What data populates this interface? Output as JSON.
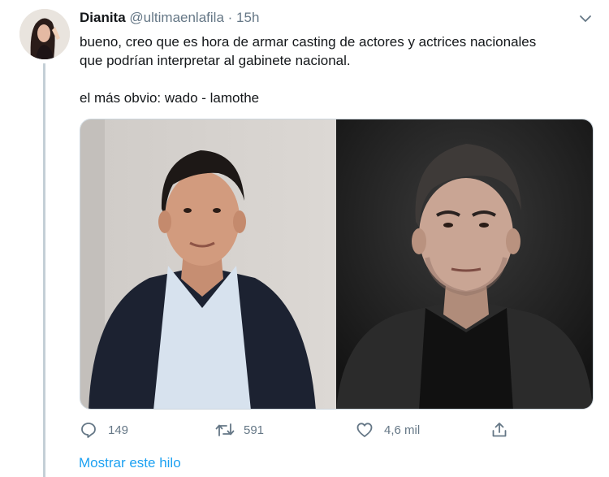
{
  "tweet": {
    "author_name": "Dianita",
    "handle": "@ultimaenlafila",
    "separator": "·",
    "time": "15h",
    "text_line1": "bueno, creo que es hora de armar casting de actores y actrices nacionales",
    "text_line2": "que podrían interpretar al gabinete nacional.",
    "text_line3": "el más obvio: wado - lamothe"
  },
  "actions": {
    "replies": "149",
    "retweets": "591",
    "likes": "4,6 mil"
  },
  "show_thread": "Mostrar este hilo",
  "colors": {
    "accent": "#1da1f2",
    "muted": "#657786",
    "thread_line": "#c4cfd6"
  }
}
